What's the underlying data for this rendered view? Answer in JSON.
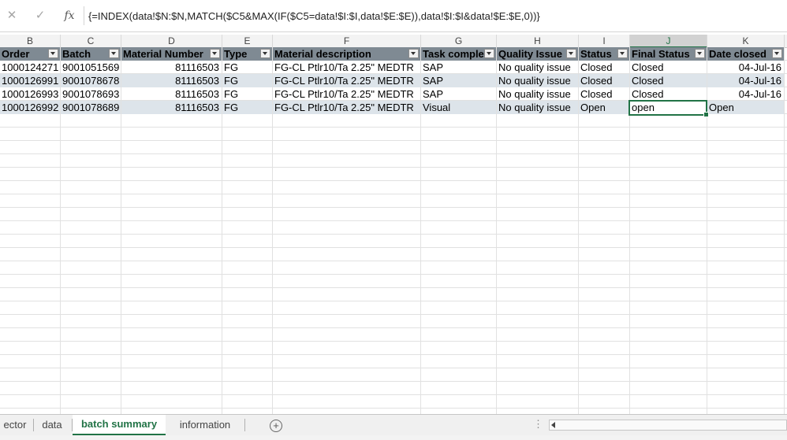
{
  "formula_bar": {
    "cancel_icon": "close-icon",
    "enter_icon": "check-icon",
    "fx_label": "fx",
    "formula": "{=INDEX(data!$N:$N,MATCH($C5&MAX(IF($C5=data!$I:$I,data!$E:$E)),data!$I:$I&data!$E:$E,0))}"
  },
  "column_letters": [
    "B",
    "C",
    "D",
    "E",
    "F",
    "G",
    "H",
    "I",
    "J",
    "K"
  ],
  "selected_column": "J",
  "table": {
    "headers": [
      "Order",
      "Batch",
      "Material Number",
      "Type",
      "Material description",
      "Task complet",
      "Quality Issue",
      "Status",
      "Final Status",
      "Date closed"
    ],
    "rows": [
      [
        "1000124271",
        "9001051569",
        "81116503",
        "FG",
        "FG-CL Ptlr10/Ta 2.25\" MEDTR",
        "SAP",
        "No quality issue",
        "Closed",
        "Closed",
        "04-Jul-16"
      ],
      [
        "1000126991",
        "9001078678",
        "81116503",
        "FG",
        "FG-CL Ptlr10/Ta 2.25\" MEDTR",
        "SAP",
        "No quality issue",
        "Closed",
        "Closed",
        "04-Jul-16"
      ],
      [
        "1000126993",
        "9001078693",
        "81116503",
        "FG",
        "FG-CL Ptlr10/Ta 2.25\" MEDTR",
        "SAP",
        "No quality issue",
        "Closed",
        "Closed",
        "04-Jul-16"
      ],
      [
        "1000126992",
        "9001078689",
        "81116503",
        "FG",
        "FG-CL Ptlr10/Ta 2.25\" MEDTR",
        "Visual",
        "No quality issue",
        "Open",
        "open",
        "Open"
      ]
    ]
  },
  "sheet_tabs": {
    "tabs": [
      "ector",
      "data",
      "batch summary",
      "information"
    ],
    "active": "batch summary",
    "add_icon": "plus-circle-icon"
  },
  "colors": {
    "accent": "#217346",
    "header_fill": "#7f8a93",
    "band_fill": "#dde4ea"
  }
}
